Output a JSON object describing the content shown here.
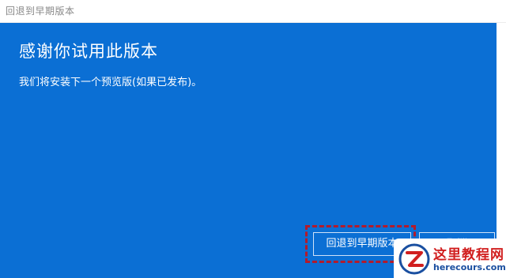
{
  "window": {
    "title": "回退到早期版本"
  },
  "main": {
    "heading": "感谢你试用此版本",
    "message": "我们将安装下一个预览版(如果已发布)。"
  },
  "buttons": {
    "rollback_label": "回退到早期版本",
    "cancel_label": "取消"
  },
  "watermark": {
    "title": "这里教程网",
    "url": "herecours.com"
  },
  "colors": {
    "panel_blue": "#0b6fd4",
    "highlight_red": "#b31b2b",
    "watermark_red": "#d11f1f",
    "watermark_blue": "#1a4fa0"
  }
}
